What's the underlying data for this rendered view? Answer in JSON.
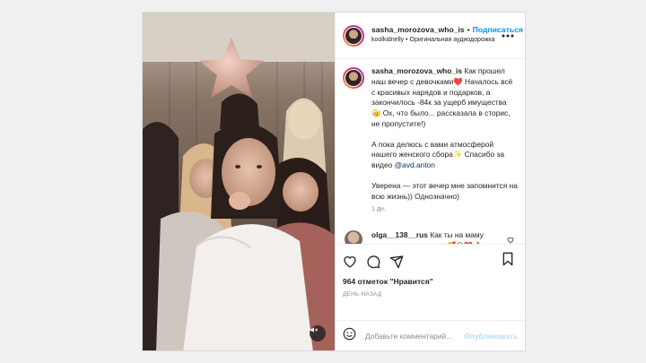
{
  "post": {
    "header": {
      "username": "sasha_morozova_who_is",
      "separator": "•",
      "follow_label": "Подписаться",
      "audio_line": "koolkidnelly • Оригинальная аудиодорожка"
    },
    "caption": {
      "username": "sasha_morozova_who_is",
      "text_part1": "Как прошел наш вечер с девочками",
      "text_part2": " Началось всё с красивых нарядов и подарков, а закончилось -84к за ущерб имущества ",
      "text_part3": " Ох, что было... рассказала в сторис, не пропустите!)",
      "paragraph2_a": "А пока делюсь с вами атмосферой нашего женского сбора",
      "paragraph2_b": " Спасибо за видео ",
      "mention": "@avd.anton",
      "paragraph3": "Уверена — этот вечер мне запомнится на всю жизнь)) Однозначно)",
      "time": "1 дн.",
      "emoji_heart": "❤️",
      "emoji_face": "🤕",
      "emoji_sparkle": "✨"
    },
    "comments": [
      {
        "username": "olga__138__rus",
        "text": "Как ты на маму похожа просто копия 🥰😍❤️🔥"
      }
    ],
    "likes": "964 отметок \"Нравится\"",
    "date_label": "ДЕНЬ НАЗАД",
    "add_comment": {
      "placeholder": "Добавьте комментарий...",
      "publish_label": "Опубликовать"
    }
  },
  "colors": {
    "accent": "#0095f6",
    "link": "#00376b",
    "muted": "#8e8e8e",
    "publish_disabled": "#b2dffc"
  }
}
